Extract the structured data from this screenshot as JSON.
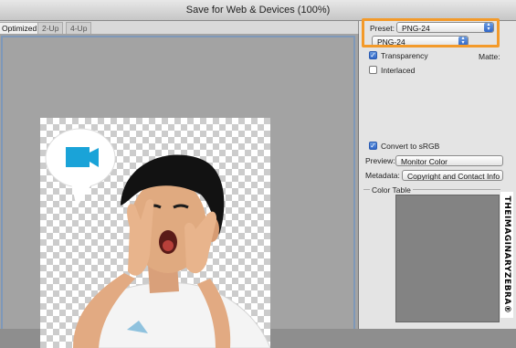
{
  "window": {
    "title": "Save for Web & Devices (100%)"
  },
  "tabs": [
    {
      "label": "Optimized",
      "active": true
    },
    {
      "label": "2-Up",
      "active": false
    },
    {
      "label": "4-Up",
      "active": false
    }
  ],
  "settings": {
    "preset_label": "Preset:",
    "preset_value": "PNG-24",
    "format_value": "PNG-24",
    "transparency_label": "Transparency",
    "transparency_checked": true,
    "matte_label": "Matte:",
    "interlaced_label": "Interlaced",
    "interlaced_checked": false,
    "convert_label": "Convert to sRGB",
    "convert_checked": true,
    "preview_label": "Preview:",
    "preview_value": "Monitor Color",
    "metadata_label": "Metadata:",
    "metadata_value": "Copyright and Contact Info",
    "color_table_label": "Color Table"
  },
  "watermark": {
    "text": "THEIMAGINARYZEBRA®"
  },
  "colors": {
    "highlight": "#f39a2a",
    "accent_blue": "#1aa3d8",
    "color_table_bg": "#838383"
  },
  "icons": {
    "bubble": "video-camera-icon"
  }
}
